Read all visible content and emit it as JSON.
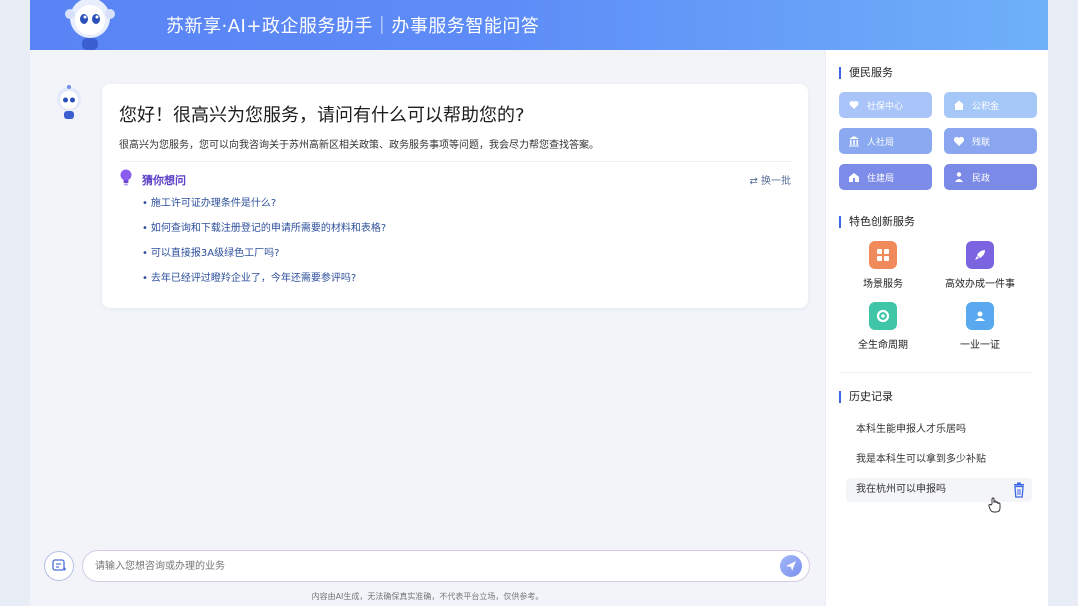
{
  "header": {
    "title": "苏新享·AI+政企服务助手｜办事服务智能问答"
  },
  "welcome": {
    "title": "您好！很高兴为您服务，请问有什么可以帮助您的?",
    "subtitle": "很高兴为您服务，您可以向我咨询关于苏州高新区相关政策、政务服务事项等问题，我会尽力帮您查找答案。",
    "guess_title": "猜你想问",
    "refresh_label": "⇄ 换一批",
    "questions": [
      "施工许可证办理条件是什么?",
      "如何查询和下载注册登记的申请所需要的材料和表格?",
      "可以直接报3A级绿色工厂吗?",
      "去年已经评过瞪羚企业了，今年还需要参评吗?"
    ]
  },
  "input": {
    "placeholder": "请输入您想咨询或办理的业务",
    "disclaimer": "内容由AI生成，无法确保真实准确，不代表平台立场，仅供参考。"
  },
  "sidebar": {
    "convenience": {
      "title": "便民服务",
      "items": [
        {
          "label": "社保中心",
          "color": "#a9c4f8",
          "icon": "heart-hand-icon"
        },
        {
          "label": "公积金",
          "color": "#a6c8f8",
          "icon": "house-icon"
        },
        {
          "label": "人社局",
          "color": "#8aa9f1",
          "icon": "bank-icon"
        },
        {
          "label": "残联",
          "color": "#8aa6f0",
          "icon": "heart-icon"
        },
        {
          "label": "住建局",
          "color": "#7d8ce8",
          "icon": "building-icon"
        },
        {
          "label": "民政",
          "color": "#7b8ae6",
          "icon": "person-icon"
        }
      ]
    },
    "featured": {
      "title": "特色创新服务",
      "items": [
        {
          "label": "场景服务",
          "color": "#f08a5a",
          "icon": "grid-icon"
        },
        {
          "label": "高效办成一件事",
          "color": "#7a64e0",
          "icon": "rocket-icon"
        },
        {
          "label": "全生命周期",
          "color": "#3ec6a7",
          "icon": "cycle-icon"
        },
        {
          "label": "一业一证",
          "color": "#5aa8f0",
          "icon": "id-card-icon"
        }
      ]
    },
    "history": {
      "title": "历史记录",
      "items": [
        "本科生能申报人才乐居吗",
        "我是本科生可以拿到多少补贴",
        "我在杭州可以申报吗"
      ]
    }
  }
}
